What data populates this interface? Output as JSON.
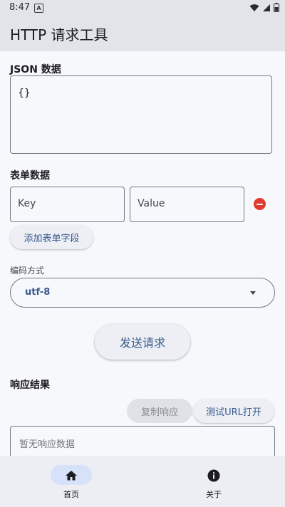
{
  "status": {
    "time": "8:47",
    "notification_letter": "A"
  },
  "app_bar": {
    "title": "HTTP 请求工具"
  },
  "json_section": {
    "label": "JSON 数据",
    "value": "{}"
  },
  "form_section": {
    "label": "表单数据",
    "key_placeholder": "Key",
    "value_placeholder": "Value",
    "add_field_label": "添加表单字段"
  },
  "encoding": {
    "label": "编码方式",
    "selected": "utf-8"
  },
  "send_button": "发送请求",
  "response": {
    "label": "响应结果",
    "copy_button": "复制响应",
    "test_url_button": "测试URL打开",
    "placeholder": "暂无响应数据"
  },
  "bottom_nav": {
    "items": [
      {
        "label": "首页",
        "icon": "home-icon",
        "active": true
      },
      {
        "label": "关于",
        "icon": "info-icon",
        "active": false
      }
    ]
  },
  "colors": {
    "accent": "#38598b",
    "remove": "#e03a30",
    "nav_indicator": "#d5e2fa"
  }
}
